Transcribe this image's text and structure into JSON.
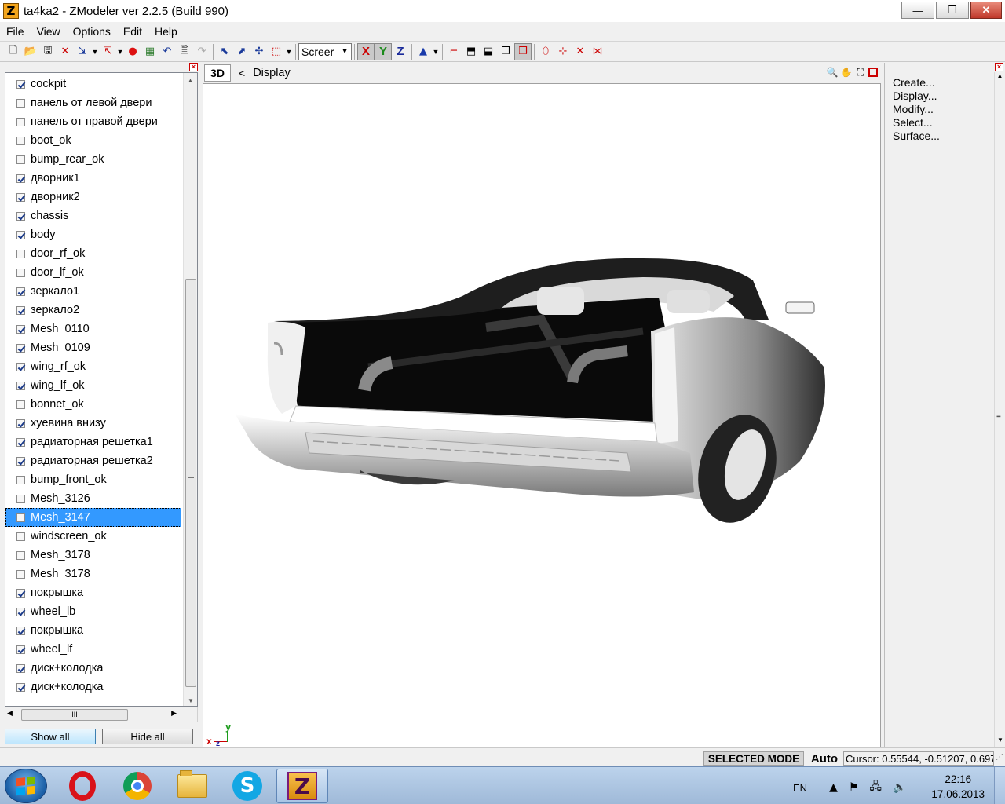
{
  "window": {
    "title": "ta4ka2 - ZModeler ver 2.2.5 (Build 990)",
    "app_icon_letter": "Z",
    "minimize": "—",
    "maximize": "❐",
    "close": "✕"
  },
  "menu": [
    "File",
    "View",
    "Options",
    "Edit",
    "Help"
  ],
  "toolbar": {
    "view_select": "Screer",
    "axis_x": "X",
    "axis_y": "Y",
    "axis_z": "Z"
  },
  "objects_panel": {
    "items": [
      {
        "label": "cockpit",
        "checked": true
      },
      {
        "label": "панель от левой двери",
        "checked": false
      },
      {
        "label": "панель от правой двери",
        "checked": false
      },
      {
        "label": "boot_ok",
        "checked": false
      },
      {
        "label": "bump_rear_ok",
        "checked": false
      },
      {
        "label": "дворник1",
        "checked": true
      },
      {
        "label": "дворник2",
        "checked": true
      },
      {
        "label": "chassis",
        "checked": true
      },
      {
        "label": "body",
        "checked": true
      },
      {
        "label": "door_rf_ok",
        "checked": false
      },
      {
        "label": "door_lf_ok",
        "checked": false
      },
      {
        "label": "зеркало1",
        "checked": true
      },
      {
        "label": "зеркало2",
        "checked": true
      },
      {
        "label": "Mesh_0110",
        "checked": true
      },
      {
        "label": "Mesh_0109",
        "checked": true
      },
      {
        "label": "wing_rf_ok",
        "checked": true
      },
      {
        "label": "wing_lf_ok",
        "checked": true
      },
      {
        "label": "bonnet_ok",
        "checked": false
      },
      {
        "label": "хуевина внизу",
        "checked": true
      },
      {
        "label": "радиаторная решетка1",
        "checked": true
      },
      {
        "label": "радиаторная решетка2",
        "checked": true
      },
      {
        "label": "bump_front_ok",
        "checked": false
      },
      {
        "label": "Mesh_3126",
        "checked": false
      },
      {
        "label": "Mesh_3147",
        "checked": false,
        "selected": true
      },
      {
        "label": "windscreen_ok",
        "checked": false
      },
      {
        "label": "Mesh_3178",
        "checked": false
      },
      {
        "label": "Mesh_3178",
        "checked": false
      },
      {
        "label": "покрышка",
        "checked": true
      },
      {
        "label": "wheel_lb",
        "checked": true
      },
      {
        "label": "покрышка",
        "checked": true
      },
      {
        "label": "wheel_lf",
        "checked": true
      },
      {
        "label": "диск+колодка",
        "checked": true
      },
      {
        "label": "диск+колодка",
        "checked": true
      }
    ],
    "show_all": "Show all",
    "hide_all": "Hide all",
    "hscroll_grip": "III"
  },
  "viewport": {
    "tab": "3D",
    "back_arrow": "<",
    "mode": "Display",
    "axis_x": "x",
    "axis_y": "y",
    "axis_z": "z"
  },
  "command_panel": {
    "items": [
      "Create...",
      "Display...",
      "Modify...",
      "Select...",
      "Surface..."
    ]
  },
  "statusbar": {
    "mode": "SELECTED MODE",
    "auto": "Auto",
    "cursor": "Cursor: 0.55544, -0.51207, 0.697"
  },
  "taskbar": {
    "language": "EN",
    "time": "22:16",
    "date": "17.06.2013"
  }
}
